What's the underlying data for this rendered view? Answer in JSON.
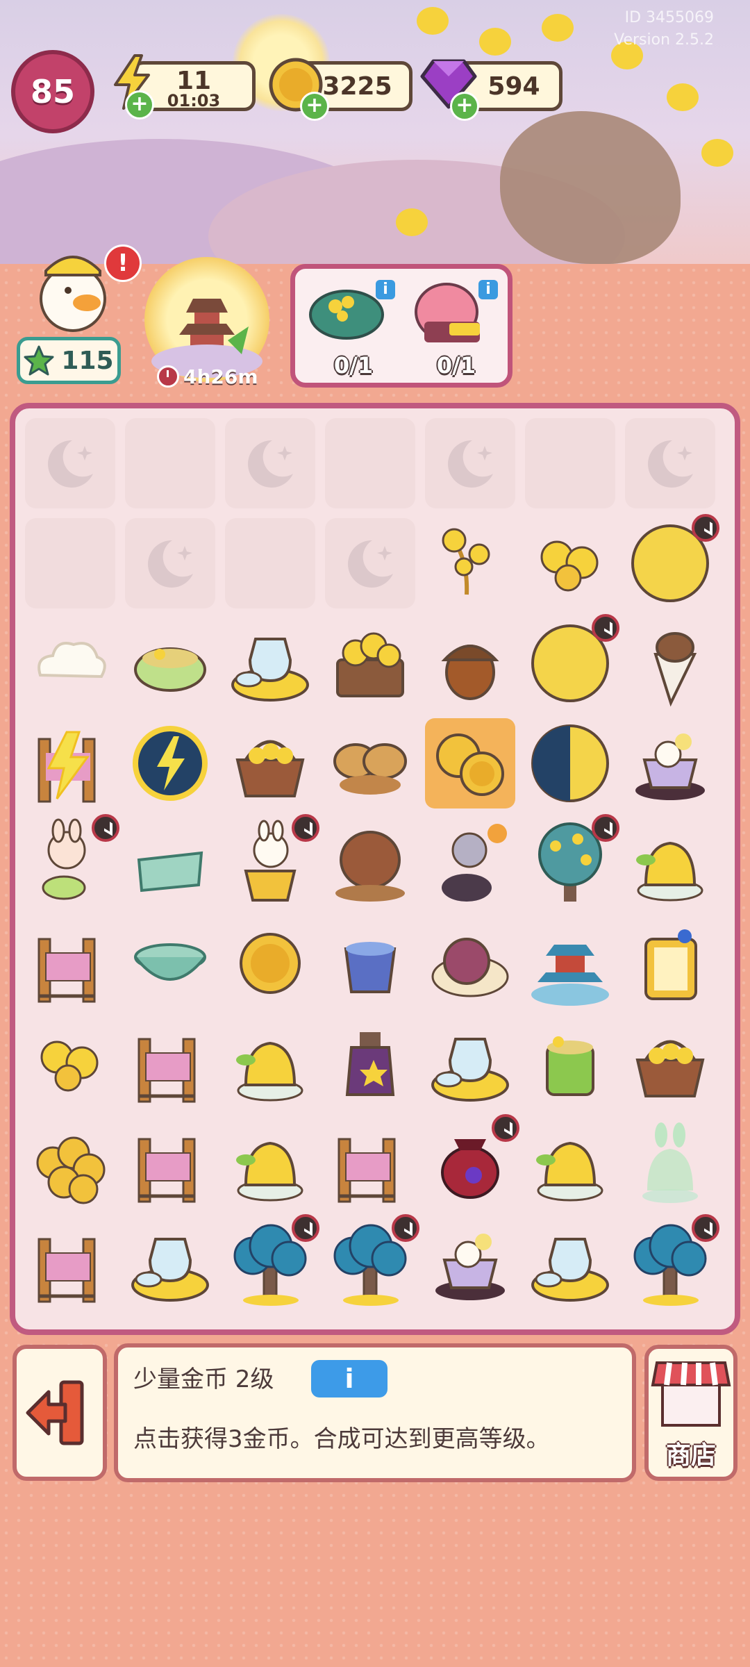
{
  "header": {
    "id_text": "ID 3455069",
    "version_text": "Version 2.5.2",
    "level": "85",
    "energy": {
      "value": "11",
      "timer": "01:03",
      "icon": "lightning-icon"
    },
    "coins": {
      "value": "53225",
      "icon": "coin-icon"
    },
    "gems": {
      "value": "594",
      "icon": "gem-icon"
    }
  },
  "player": {
    "stars": "115"
  },
  "event": {
    "timer": "4h26m"
  },
  "orders": [
    {
      "icon": "leaf-bundle-icon",
      "count": "0/1"
    },
    {
      "icon": "mooncake-box-icon",
      "count": "0/1"
    }
  ],
  "board": {
    "rows": [
      [
        "locked",
        "empty",
        "locked",
        "empty",
        "locked",
        "empty",
        "locked"
      ],
      [
        "empty",
        "locked",
        "empty",
        "locked",
        "osmanthus-branch",
        "osmanthus-flowers",
        "moon-full"
      ],
      [
        "cloud",
        "tea-cup",
        "porcelain-set",
        "flower-box",
        "acorn",
        "moon-full",
        "ice-cream-cone"
      ],
      [
        "loom-energy",
        "energy-orb",
        "flower-basket",
        "bread-rolls",
        "gold-coins-selected",
        "moon-half",
        "bunny-cup"
      ],
      [
        "bunny-pounding",
        "jade-plate",
        "bunny-mortar",
        "pig-bread",
        "bunny-drummer",
        "osmanthus-tree",
        "jelly-dessert"
      ],
      [
        "loom",
        "jade-bowl",
        "gold-coin",
        "blue-cup",
        "mooncake",
        "pagoda",
        "lantern-box"
      ],
      [
        "osmanthus-flowers",
        "loom",
        "jelly-dessert",
        "potion-bottle",
        "porcelain-set",
        "tea-cup-green",
        "flower-basket"
      ],
      [
        "coin-pile",
        "loom",
        "jelly-dessert",
        "loom",
        "red-teapot",
        "jelly-dessert",
        "bunny-jelly"
      ],
      [
        "loom",
        "porcelain-set",
        "moon-tree",
        "moon-tree",
        "bunny-cup",
        "porcelain-set",
        "moon-tree"
      ]
    ]
  },
  "info_panel": {
    "title": "少量金币 2级",
    "info_button": "i",
    "description": "点击获得3金币。合成可达到更高等级。"
  },
  "shop": {
    "label": "商店"
  },
  "colors": {
    "accent": "#c05a80",
    "panel": "#fff7e6",
    "info_blue": "#3d9be8"
  }
}
